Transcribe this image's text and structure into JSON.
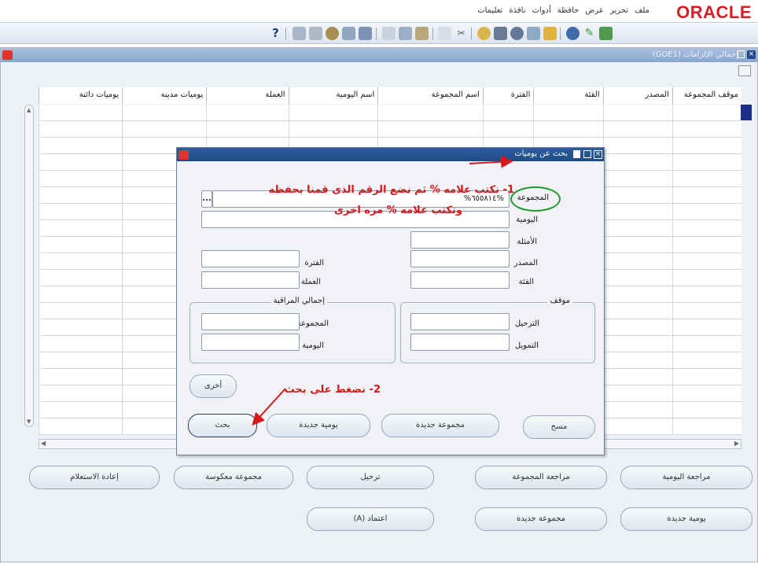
{
  "app": {
    "logo": "ORACLE",
    "menu": [
      "ملف",
      "تحرير",
      "عرض",
      "حافظة",
      "أدوات",
      "نافذة",
      "تعليمات"
    ]
  },
  "colors": {
    "oracle_red": "#d32027",
    "title_blue": "#1f4a86",
    "annotation_red": "#d7191c",
    "highlight_green": "#1f9a2c"
  },
  "toolbar_icons": [
    "new-icon",
    "open-icon",
    "save-icon",
    "print-icon",
    "close-form-icon",
    "navigator-icon",
    "zoom-icon",
    "translate-icon",
    "attachment-icon",
    "cut-icon",
    "copy-icon",
    "paste-icon",
    "clear-record-icon",
    "delete-record-icon",
    "edit-field-icon",
    "find-icon",
    "folder-icon",
    "attach-icon",
    "tools-icon",
    "help-icon"
  ],
  "background_window": {
    "title": "إجمالي الإلزامات (GOE1)",
    "columns": [
      "موقف المجموعة",
      "المصدر",
      "الفئة",
      "الفترة",
      "اسم المجموعة",
      "اسم اليومية",
      "العملة",
      "يوميات مدينة",
      "يوميات دائنة"
    ],
    "buttons_row1": [
      "مراجعة اليومية",
      "مراجعة المجموعة",
      "ترحيل",
      "مجموعة معكوسة",
      "إعادة الاستعلام"
    ],
    "buttons_row2": [
      "يومية جديدة",
      "مجموعة جديدة",
      "اعتماد (A)"
    ]
  },
  "dialog": {
    "title": "بحث عن يوميات",
    "fields": {
      "batch_label": "المجموعة",
      "batch_value": "%٦٥٥٨١٤%",
      "journal_label": "اليومية",
      "journal_value": "",
      "category_label": "الأمثلة",
      "source_label": "المصدر",
      "class_label": "الفئة",
      "period_label": "الفترة",
      "currency_label": "العملة"
    },
    "status_group": {
      "title": "موقف",
      "posting_label": "الترحيل",
      "funding_label": "التمويل"
    },
    "control_group": {
      "title": "إجمالي المراقبة",
      "batch_label": "المجموعة",
      "journal_label": "اليومية"
    },
    "buttons": {
      "other": "أخرى",
      "clear": "مسح",
      "new_batch": "مجموعة جديدة",
      "new_journal": "يومية جديدة",
      "find": "بحث"
    },
    "ellipsis": "..."
  },
  "annotations": {
    "step1_line1": "1- نكتب علامه % ثم نضع الرقم الذى قمنا بحفظه",
    "step1_line2": "ونكتب علامه % مره اخرى",
    "step2": "2- نضغط على بحث"
  }
}
